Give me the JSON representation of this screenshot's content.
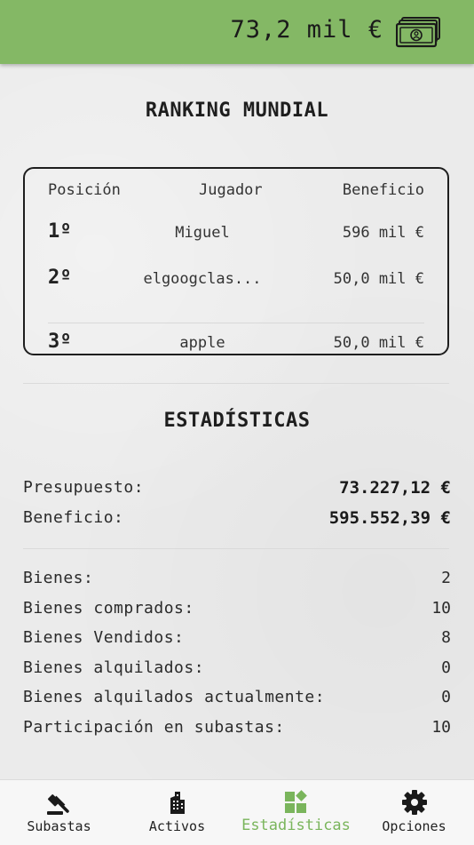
{
  "header": {
    "balance": "73,2 mil €",
    "icon": "money-bills-icon",
    "accent": "#84b865"
  },
  "ranking": {
    "title": "RANKING MUNDIAL",
    "columns": [
      "Posición",
      "Jugador",
      "Beneficio"
    ],
    "rows": [
      {
        "pos": "1º",
        "player": "Miguel",
        "profit": "596 mil €"
      },
      {
        "pos": "2º",
        "player": "elgoogclas...",
        "profit": "50,0 mil €"
      },
      {
        "pos": "3º",
        "player": "apple",
        "profit": "50,0 mil €"
      }
    ]
  },
  "stats": {
    "title": "ESTADÍSTICAS",
    "budget_label": "Presupuesto:",
    "budget_value": "73.227,12 €",
    "profit_label": "Beneficio:",
    "profit_value": "595.552,39 €",
    "items": [
      {
        "label": "Bienes:",
        "value": "2"
      },
      {
        "label": "Bienes comprados:",
        "value": "10"
      },
      {
        "label": "Bienes Vendidos:",
        "value": "8"
      },
      {
        "label": "Bienes alquilados:",
        "value": "0"
      },
      {
        "label": "Bienes alquilados actualmente:",
        "value": "0"
      },
      {
        "label": "Participación en subastas:",
        "value": "10"
      }
    ]
  },
  "nav": {
    "items": [
      {
        "label": "Subastas",
        "icon": "gavel-icon"
      },
      {
        "label": "Activos",
        "icon": "buildings-icon"
      },
      {
        "label": "Estadísticas",
        "icon": "dashboard-icon",
        "active": true
      },
      {
        "label": "Opciones",
        "icon": "gear-icon"
      }
    ],
    "active_color": "#7ab55c"
  }
}
